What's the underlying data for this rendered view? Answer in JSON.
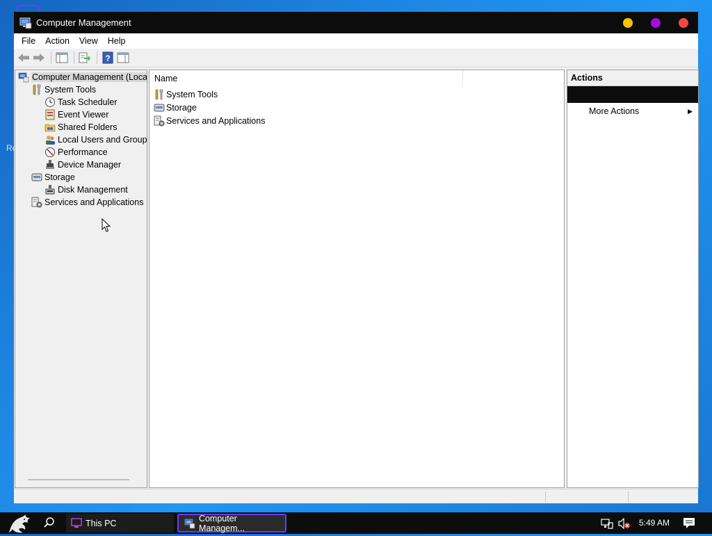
{
  "window": {
    "title": "Computer Management",
    "controls": {
      "minimize_color": "#f5c400",
      "maximize_color": "#a20ce0",
      "close_color": "#f04848"
    }
  },
  "menu": [
    "File",
    "Action",
    "View",
    "Help"
  ],
  "toolbar": {
    "buttons": [
      "back-arrow-icon",
      "forward-arrow-icon",
      "show-hide-console-tree-icon",
      "export-list-icon",
      "help-icon",
      "show-hide-action-pane-icon"
    ]
  },
  "tree": {
    "root": "Computer Management (Local",
    "system_tools": "System Tools",
    "task_scheduler": "Task Scheduler",
    "event_viewer": "Event Viewer",
    "shared_folders": "Shared Folders",
    "local_users": "Local Users and Groups",
    "performance": "Performance",
    "device_manager": "Device Manager",
    "storage": "Storage",
    "disk_management": "Disk Management",
    "services": "Services and Applications"
  },
  "list": {
    "column_name": "Name",
    "rows": [
      "System Tools",
      "Storage",
      "Services and Applications"
    ]
  },
  "actions": {
    "header": "Actions",
    "more_actions": "More Actions"
  },
  "taskbar": {
    "items": [
      "This PC",
      "Computer Managem..."
    ],
    "clock": "5:49 AM",
    "accent": "#6a3cff"
  },
  "desktop": {
    "fragments": [
      "Re"
    ]
  }
}
